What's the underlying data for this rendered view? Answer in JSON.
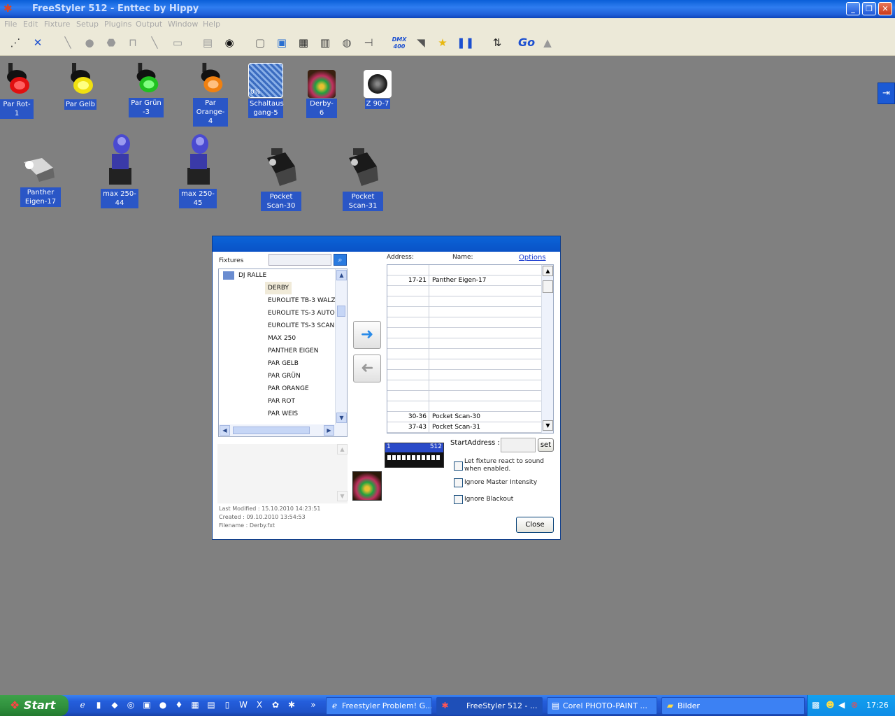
{
  "window": {
    "title": "FreeStyler 512 - Enttec by Hippy",
    "min": "_",
    "max": "❐",
    "close": "✕"
  },
  "menu": [
    "File",
    "Edit",
    "Fixture",
    "Setup",
    "Plugins",
    "Output",
    "Window",
    "Help"
  ],
  "toolbar": {
    "dmx_label": "DMX",
    "dmx_sub": "400",
    "go_label": "Go"
  },
  "fixtures_row1": [
    {
      "label": "Par Rot-1",
      "color": "#e01010"
    },
    {
      "label": "Par Gelb",
      "color": "#f0e010"
    },
    {
      "label": "Par Grün -3",
      "color": "#20c020"
    },
    {
      "label": "Par Orange-4",
      "color": "#f08010"
    },
    {
      "label": "Schaltaus gang-5",
      "color": "#3b6cc0",
      "badge": "0%"
    },
    {
      "label": "Derby-6",
      "color": "#8a4a10"
    },
    {
      "label": "Z 90-7",
      "color": "#dddddd"
    }
  ],
  "fixtures_row2": [
    {
      "label": "Panther Eigen-17"
    },
    {
      "label": "max 250-44"
    },
    {
      "label": "max 250-45"
    },
    {
      "label": "Pocket Scan-30"
    },
    {
      "label": "Pocket Scan-31"
    }
  ],
  "dialog": {
    "fixtures_label": "Fixtures",
    "search_value": "",
    "tree_root": "DJ RALLE",
    "tree_items": [
      "DERBY",
      "EUROLITE TB-3 WALZ",
      "EUROLITE TS-3 AUTO",
      "EUROLITE TS-3 SCAN",
      "MAX 250",
      "PANTHER EIGEN",
      "PAR GELB",
      "PAR GRÜN",
      "PAR ORANGE",
      "PAR ROT",
      "PAR WEIS"
    ],
    "address_header": "Address:",
    "name_header": "Name:",
    "options_link": "Options",
    "rows": [
      {
        "addr": "",
        "name": ""
      },
      {
        "addr": "17-21",
        "name": "Panther Eigen-17"
      },
      {
        "addr": "",
        "name": ""
      },
      {
        "addr": "",
        "name": ""
      },
      {
        "addr": "",
        "name": ""
      },
      {
        "addr": "",
        "name": ""
      },
      {
        "addr": "",
        "name": ""
      },
      {
        "addr": "",
        "name": ""
      },
      {
        "addr": "",
        "name": ""
      },
      {
        "addr": "",
        "name": ""
      },
      {
        "addr": "",
        "name": ""
      },
      {
        "addr": "",
        "name": ""
      },
      {
        "addr": "",
        "name": ""
      },
      {
        "addr": "",
        "name": ""
      },
      {
        "addr": "30-36",
        "name": "Pocket Scan-30"
      },
      {
        "addr": "37-43",
        "name": "Pocket Scan-31"
      }
    ],
    "dmx_start": "1",
    "dmx_end": "512",
    "start_address_label": "StartAddress :",
    "start_address_value": "",
    "set_label": "set",
    "chk_sound": "Let fixture react to sound when enabled.",
    "chk_master": "Ignore Master Intensity",
    "chk_blackout": "Ignore Blackout",
    "last_modified": "Last Modified : 15.10.2010 14:23:51",
    "created": "Created : 09.10.2010 13:54:53",
    "filename": "Filename : Derby.fxt",
    "close_label": "Close"
  },
  "taskbar": {
    "start": "Start",
    "tasks": [
      "Freestyler Problem! G...",
      "FreeStyler 512 - ...",
      "Corel PHOTO-PAINT ...",
      "Bilder"
    ],
    "clock": "17:26",
    "overflow": "»"
  },
  "colors": {
    "title_blue": "#1e5ed8",
    "taskbar_blue": "#245edc",
    "start_green": "#2f8f3c",
    "label_blue": "#2a56c6"
  }
}
